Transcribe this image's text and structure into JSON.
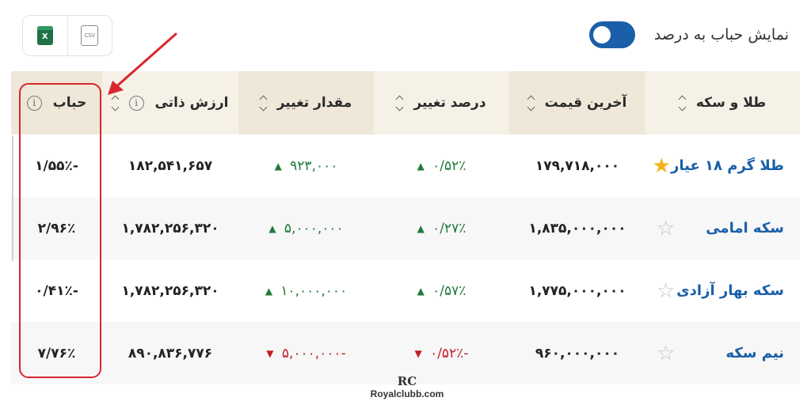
{
  "export": {
    "excel_icon": "excel-icon",
    "excel_glyph": "X",
    "csv_icon": "csv-file-icon",
    "csv_glyph": "CSV"
  },
  "toggle": {
    "label": "نمایش حباب به درصد",
    "state": "on",
    "color": "#1a5fa8"
  },
  "table": {
    "headers": {
      "name": "طلا و سکه",
      "last_price": "آخرین قیمت",
      "change_percent": "درصد تغییر",
      "change_amount": "مقدار تغییر",
      "intrinsic_value": "ارزش ذاتی",
      "bubble": "حباب"
    },
    "rows": [
      {
        "name": "طلا گرم ۱۸ عیار",
        "favorite": true,
        "last_price": "۱۷۹,۷۱۸,۰۰۰",
        "change_percent": "۰/۵۲٪",
        "change_amount": "۹۲۳,۰۰۰",
        "direction": "up",
        "intrinsic_value": "۱۸۲,۵۴۱,۶۵۷",
        "bubble": "-۱/۵۵٪"
      },
      {
        "name": "سکه امامی",
        "favorite": false,
        "last_price": "۱,۸۳۵,۰۰۰,۰۰۰",
        "change_percent": "۰/۲۷٪",
        "change_amount": "۵,۰۰۰,۰۰۰",
        "direction": "up",
        "intrinsic_value": "۱,۷۸۲,۲۵۶,۳۲۰",
        "bubble": "۲/۹۶٪"
      },
      {
        "name": "سکه بهار آزادی",
        "favorite": false,
        "last_price": "۱,۷۷۵,۰۰۰,۰۰۰",
        "change_percent": "۰/۵۷٪",
        "change_amount": "۱۰,۰۰۰,۰۰۰",
        "direction": "up",
        "intrinsic_value": "۱,۷۸۲,۲۵۶,۳۲۰",
        "bubble": "-۰/۴۱٪"
      },
      {
        "name": "نیم سکه",
        "favorite": false,
        "last_price": "۹۶۰,۰۰۰,۰۰۰",
        "change_percent": "-۰/۵۲٪",
        "change_amount": "-۵,۰۰۰,۰۰۰",
        "direction": "down",
        "intrinsic_value": "۸۹۰,۸۳۶,۷۷۶",
        "bubble": "۷/۷۶٪"
      }
    ]
  },
  "colors": {
    "positive": "#1f7a3a",
    "negative": "#c0202a",
    "link": "#1a5fa8",
    "header_bg": "#f6f1e6",
    "annotation": "#d9262e"
  },
  "watermark": {
    "logo": "RC",
    "text": "Royalclubb.com"
  }
}
